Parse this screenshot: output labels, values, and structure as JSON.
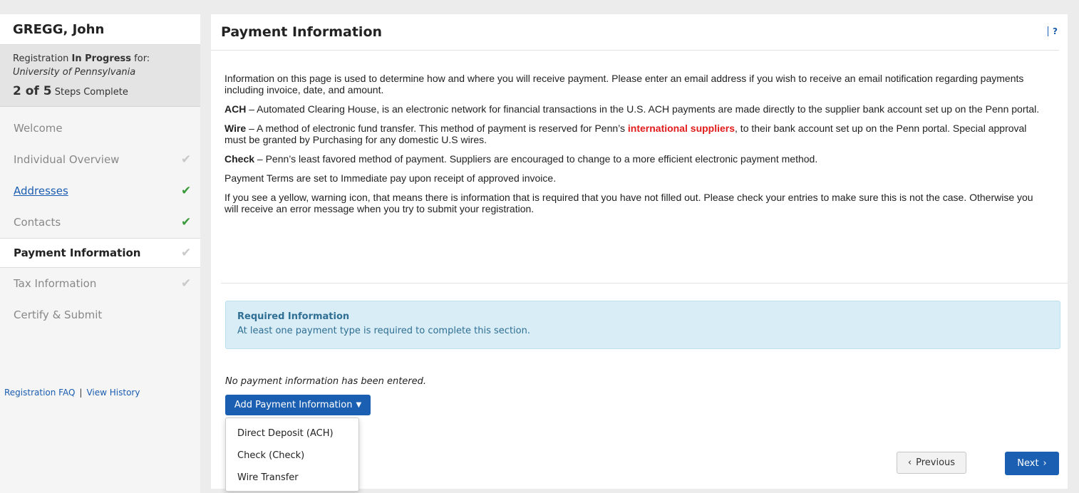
{
  "sidebar": {
    "name": "GREGG, John",
    "status_prefix": "Registration ",
    "status_bold": "In Progress",
    "status_suffix": " for:",
    "university": "University of Pennsylvania",
    "steps_count": "2 of 5",
    "steps_label": "Steps Complete",
    "items": [
      {
        "label": "Welcome",
        "check": ""
      },
      {
        "label": "Individual Overview",
        "check": "✔"
      },
      {
        "label": "Addresses",
        "check": "✔"
      },
      {
        "label": "Contacts",
        "check": "✔"
      },
      {
        "label": "Payment Information",
        "check": "✔"
      },
      {
        "label": "Tax Information",
        "check": "✔"
      },
      {
        "label": "Certify & Submit",
        "check": ""
      }
    ],
    "faq_link": "Registration FAQ",
    "link_separator": "|",
    "history_link": "View History"
  },
  "main": {
    "title": "Payment Information",
    "help": "?",
    "intro1": "Information on this page is used to determine how and where you will receive payment. Please enter an email address if you wish to receive an email notification regarding payments including invoice, date, and amount.",
    "ach_term": "ACH",
    "ach_text": " – Automated Clearing House, is an electronic network for financial transactions in the U.S.  ACH payments are made directly to the supplier bank account set up on the Penn portal.",
    "wire_term": "Wire",
    "wire_text_a": " – A method of electronic fund transfer.  This method of payment is reserved for Penn’s ",
    "wire_highlight": "international suppliers",
    "wire_text_b": ", to their bank account set up on the Penn portal.  Special approval must be granted by Purchasing for any domestic U.S wires.",
    "check_term": "Check",
    "check_text": " – Penn’s least favored method of payment.  Suppliers are encouraged to change to a more efficient electronic payment method.",
    "terms": "Payment Terms are set to Immediate pay upon receipt of approved invoice.",
    "warning": "If you see a yellow, warning icon, that means there is information that is required that you have not filled out. Please check your entries to make sure this is not the case. Otherwise you will receive an error message when you try to submit your registration.",
    "alert_title": "Required Information",
    "alert_text": "At least one payment type is required to complete this section.",
    "none_msg": "No payment information has been entered.",
    "add_button": "Add Payment Information",
    "dropdown": [
      "Direct Deposit (ACH)",
      "Check (Check)",
      "Wire Transfer"
    ],
    "previous": "Previous",
    "next": "Next"
  },
  "colors": {
    "primary": "#1b5fb2",
    "check_done": "#3a9a3a",
    "check_pending": "#c9c9c9",
    "highlight": "#e21b1b",
    "alert_bg": "#d9edf7"
  },
  "icons": [
    "checkmark-icon",
    "caret-down-icon",
    "chevron-left-icon",
    "chevron-right-icon"
  ]
}
